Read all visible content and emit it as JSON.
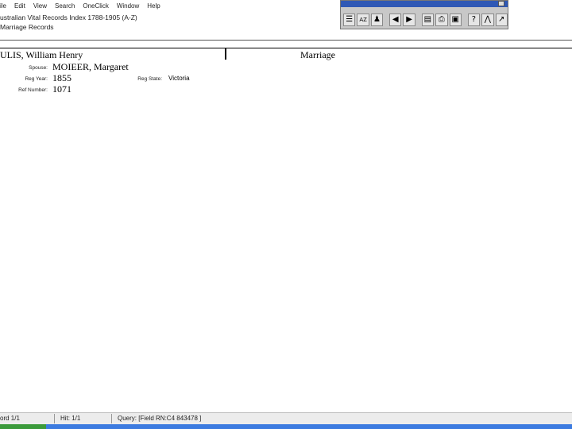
{
  "menu": [
    "ile",
    "Edit",
    "View",
    "Search",
    "OneClick",
    "Window",
    "Help"
  ],
  "document": {
    "title": "ustralian Vital Records Index 1788-1905 (A-Z)",
    "subtitle": "Marriage Records"
  },
  "toolbar": {
    "buttons": [
      {
        "name": "list-view-icon",
        "glyph": "☰"
      },
      {
        "name": "sort-az-icon",
        "glyph": "AZ"
      },
      {
        "name": "people-icon",
        "glyph": "♟"
      },
      {
        "name": "back-arrow-icon",
        "glyph": "◀"
      },
      {
        "name": "forward-arrow-icon",
        "glyph": "▶"
      },
      {
        "name": "record-view-icon",
        "glyph": "▤"
      },
      {
        "name": "print-icon",
        "glyph": "⎙"
      },
      {
        "name": "save-icon",
        "glyph": "▣"
      },
      {
        "name": "help-icon",
        "glyph": "?"
      },
      {
        "name": "family-tree-icon",
        "glyph": "⋀"
      },
      {
        "name": "export-icon",
        "glyph": "↗"
      }
    ]
  },
  "record": {
    "name": "ULIS, William Henry",
    "type": "Marriage",
    "fields": {
      "spouse_label": "Spouse:",
      "spouse": "MOIEER, Margaret",
      "reg_year_label": "Reg Year:",
      "reg_year": "1855",
      "reg_state_label": "Reg State:",
      "reg_state": "Victoria",
      "ref_number_label": "Ref Number:",
      "ref_number": "1071"
    }
  },
  "status": {
    "record": "ord 1/1",
    "hit": "Hit: 1/1",
    "query": "Query: [Field RN:C4 843478 ]"
  },
  "colors": {
    "toolbar_title": "#2f58b5",
    "taskbar": "#3c7be0",
    "start_button": "#3b9a3b"
  }
}
